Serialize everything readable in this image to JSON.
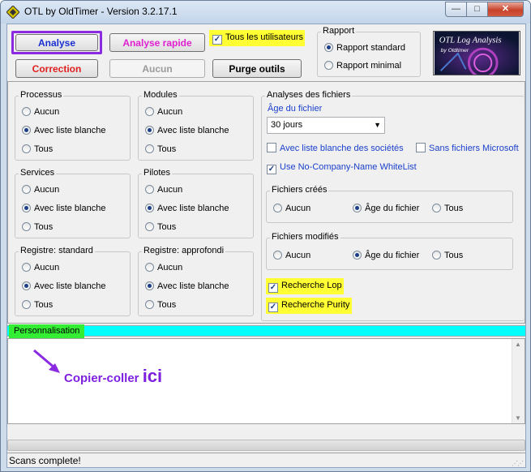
{
  "window": {
    "title": "OTL by OldTimer - Version 3.2.17.1",
    "close_glyph": "✕",
    "min_glyph": "—",
    "max_glyph": "□"
  },
  "toolbar": {
    "analyse": "Analyse",
    "analyse_rapide": "Analyse rapide",
    "correction": "Correction",
    "aucun": "Aucun",
    "purge": "Purge outils",
    "tous_utilisateurs": "Tous les utilisateurs",
    "tous_utilisateurs_checked": true
  },
  "rapport": {
    "title": "Rapport",
    "options": [
      "Rapport standard",
      "Rapport minimal"
    ],
    "selected": 0
  },
  "logo": {
    "line1": "OTL Log Analysis",
    "line2": "by Oldtimer"
  },
  "groups": [
    {
      "title": "Processus",
      "options": [
        "Aucun",
        "Avec liste blanche",
        "Tous"
      ],
      "selected": 1
    },
    {
      "title": "Modules",
      "options": [
        "Aucun",
        "Avec liste blanche",
        "Tous"
      ],
      "selected": 1
    },
    {
      "title": "Services",
      "options": [
        "Aucun",
        "Avec liste blanche",
        "Tous"
      ],
      "selected": 1
    },
    {
      "title": "Pilotes",
      "options": [
        "Aucun",
        "Avec liste blanche",
        "Tous"
      ],
      "selected": 1
    },
    {
      "title": "Registre: standard",
      "options": [
        "Aucun",
        "Avec liste blanche",
        "Tous"
      ],
      "selected": 1
    },
    {
      "title": "Registre: approfondi",
      "options": [
        "Aucun",
        "Avec liste blanche",
        "Tous"
      ],
      "selected": 1
    }
  ],
  "analyses": {
    "title": "Analyses des fichiers",
    "age_label": "Âge du fichier",
    "age_value": "30 jours",
    "checks": [
      {
        "label": "Avec liste blanche des sociétés",
        "checked": false
      },
      {
        "label": "Sans fichiers Microsoft",
        "checked": false
      },
      {
        "label": "Use No-Company-Name WhiteList",
        "checked": true
      }
    ],
    "fichiers_crees": {
      "title": "Fichiers créés",
      "options": [
        "Aucun",
        "Âge du fichier",
        "Tous"
      ],
      "selected": 1
    },
    "fichiers_modifies": {
      "title": "Fichiers modifiés",
      "options": [
        "Aucun",
        "Âge du fichier",
        "Tous"
      ],
      "selected": 1
    },
    "recherche_lop": {
      "label": "Recherche Lop",
      "checked": true
    },
    "recherche_purity": {
      "label": "Recherche Purity",
      "checked": true
    }
  },
  "personnalisation": {
    "label": "Personnalisation"
  },
  "annotation": {
    "text": "Copier-coller ",
    "big": "ici"
  },
  "status": {
    "text": "Scans complete!"
  }
}
